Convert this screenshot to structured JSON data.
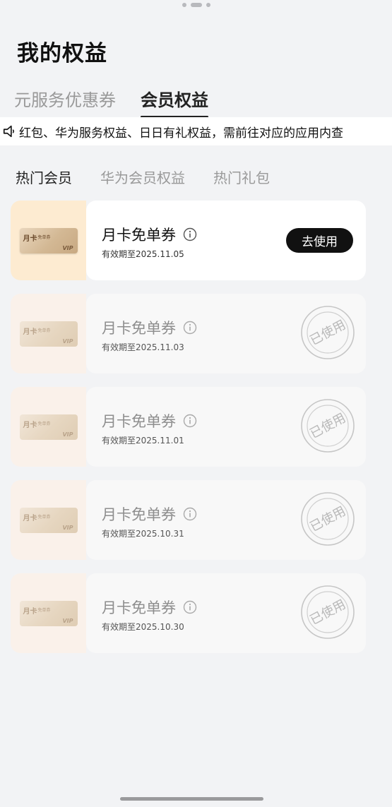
{
  "page": {
    "title": "我的权益"
  },
  "main_tabs": [
    {
      "label": "元服务优惠券",
      "active": false
    },
    {
      "label": "会员权益",
      "active": true
    }
  ],
  "notice": {
    "icon": "speaker-icon",
    "text": "红包、华为服务权益、日日有礼权益，需前往对应的应用内查"
  },
  "sub_tabs": [
    {
      "label": "热门会员",
      "active": true
    },
    {
      "label": "华为会员权益",
      "active": false
    },
    {
      "label": "热门礼包",
      "active": false
    }
  ],
  "coupons": [
    {
      "card_title": "月卡",
      "card_sub": "免单券",
      "card_badge": "VIP",
      "name": "月卡免单券",
      "expiry": "有效期至2025.11.05",
      "action": "去使用",
      "status": "available"
    },
    {
      "card_title": "月卡",
      "card_sub": "免单券",
      "card_badge": "VIP",
      "name": "月卡免单券",
      "expiry": "有效期至2025.11.03",
      "stamp": "已使用",
      "status": "used"
    },
    {
      "card_title": "月卡",
      "card_sub": "免单券",
      "card_badge": "VIP",
      "name": "月卡免单券",
      "expiry": "有效期至2025.11.01",
      "stamp": "已使用",
      "status": "used"
    },
    {
      "card_title": "月卡",
      "card_sub": "免单券",
      "card_badge": "VIP",
      "name": "月卡免单券",
      "expiry": "有效期至2025.10.31",
      "stamp": "已使用",
      "status": "used"
    },
    {
      "card_title": "月卡",
      "card_sub": "免单券",
      "card_badge": "VIP",
      "name": "月卡免单券",
      "expiry": "有效期至2025.10.30",
      "stamp": "已使用",
      "status": "used"
    }
  ],
  "colors": {
    "background": "#f2f3f5",
    "accent": "#111111",
    "card_highlight": "#fdebd1",
    "card_used": "#faf1ea"
  }
}
